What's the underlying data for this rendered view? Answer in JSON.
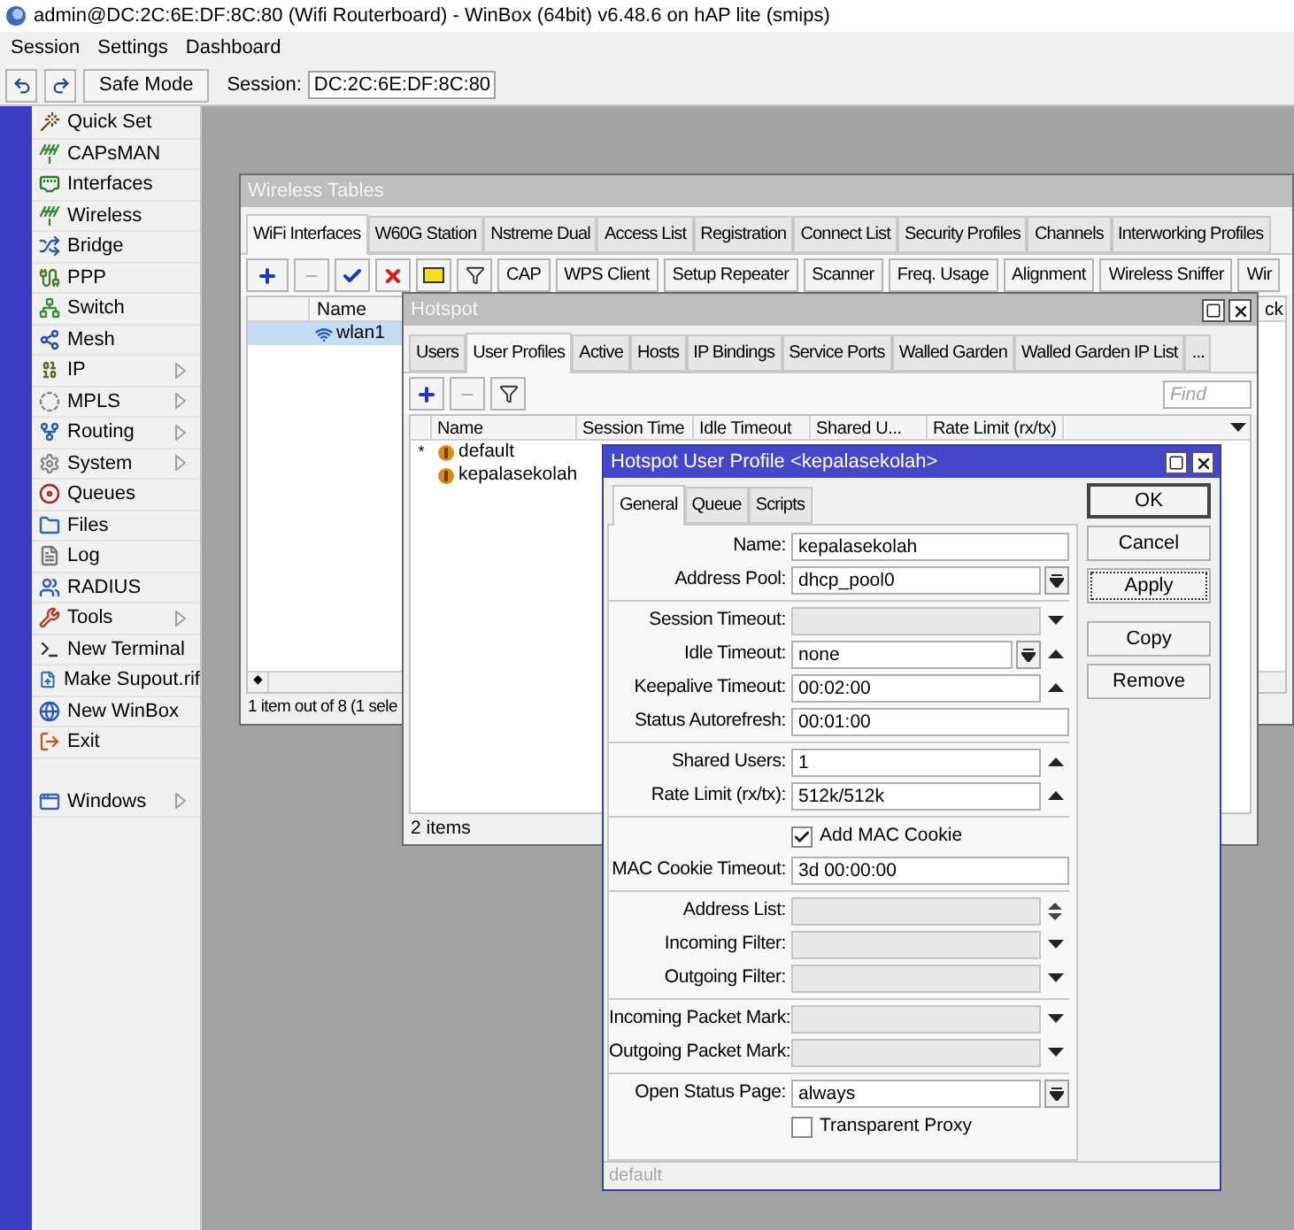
{
  "window": {
    "title": "admin@DC:2C:6E:DF:8C:80 (Wifi Routerboard) - WinBox (64bit) v6.48.6 on hAP lite (smips)"
  },
  "menu": [
    "Session",
    "Settings",
    "Dashboard"
  ],
  "toolbar": {
    "safe_mode": "Safe Mode",
    "session_label": "Session:",
    "session_value": "DC:2C:6E:DF:8C:80"
  },
  "sidebar": {
    "items": [
      {
        "label": "Quick Set",
        "submenu": false
      },
      {
        "label": "CAPsMAN",
        "submenu": false
      },
      {
        "label": "Interfaces",
        "submenu": false
      },
      {
        "label": "Wireless",
        "submenu": false
      },
      {
        "label": "Bridge",
        "submenu": false
      },
      {
        "label": "PPP",
        "submenu": false
      },
      {
        "label": "Switch",
        "submenu": false
      },
      {
        "label": "Mesh",
        "submenu": false
      },
      {
        "label": "IP",
        "submenu": true
      },
      {
        "label": "MPLS",
        "submenu": true
      },
      {
        "label": "Routing",
        "submenu": true
      },
      {
        "label": "System",
        "submenu": true
      },
      {
        "label": "Queues",
        "submenu": false
      },
      {
        "label": "Files",
        "submenu": false
      },
      {
        "label": "Log",
        "submenu": false
      },
      {
        "label": "RADIUS",
        "submenu": false
      },
      {
        "label": "Tools",
        "submenu": true
      },
      {
        "label": "New Terminal",
        "submenu": false
      },
      {
        "label": "Make Supout.rif",
        "submenu": false
      },
      {
        "label": "New WinBox",
        "submenu": false
      },
      {
        "label": "Exit",
        "submenu": false
      }
    ],
    "bottom_items": [
      {
        "label": "Windows",
        "submenu": true
      }
    ]
  },
  "wireless_tables": {
    "title": "Wireless Tables",
    "tabs": [
      {
        "label": "WiFi Interfaces",
        "selected": true
      },
      {
        "label": "W60G Station",
        "selected": false
      },
      {
        "label": "Nstreme Dual",
        "selected": false
      },
      {
        "label": "Access List",
        "selected": false
      },
      {
        "label": "Registration",
        "selected": false
      },
      {
        "label": "Connect List",
        "selected": false
      },
      {
        "label": "Security Profiles",
        "selected": false
      },
      {
        "label": "Channels",
        "selected": false
      },
      {
        "label": "Interworking Profiles",
        "selected": false
      }
    ],
    "tools": [
      "CAP",
      "WPS Client",
      "Setup Repeater",
      "Scanner",
      "Freq. Usage",
      "Alignment",
      "Wireless Sniffer",
      "Wir"
    ],
    "columns": [
      "Name",
      "ck"
    ],
    "rows": [
      {
        "name": "wlan1",
        "selected": true
      }
    ],
    "scroll_mark": "◆",
    "status": "1 item out of 8 (1 sele"
  },
  "hotspot": {
    "title": "Hotspot",
    "tabs": [
      {
        "label": "Users",
        "selected": false
      },
      {
        "label": "User Profiles",
        "selected": true
      },
      {
        "label": "Active",
        "selected": false
      },
      {
        "label": "Hosts",
        "selected": false
      },
      {
        "label": "IP Bindings",
        "selected": false
      },
      {
        "label": "Service Ports",
        "selected": false
      },
      {
        "label": "Walled Garden",
        "selected": false
      },
      {
        "label": "Walled Garden IP List",
        "selected": false
      },
      {
        "label": "...",
        "selected": false
      }
    ],
    "find_placeholder": "Find",
    "columns": [
      "Name",
      "Session Time",
      "Idle Timeout",
      "Shared U...",
      "Rate Limit (rx/tx)"
    ],
    "rows": [
      {
        "flag": "*",
        "name": "default",
        "selected": false
      },
      {
        "name": "kepalasekolah",
        "selected": false
      }
    ],
    "status": "2 items"
  },
  "dialog": {
    "title": "Hotspot User Profile <kepalasekolah>",
    "tabs": [
      {
        "label": "General",
        "selected": true
      },
      {
        "label": "Queue",
        "selected": false
      },
      {
        "label": "Scripts",
        "selected": false
      }
    ],
    "sections": [
      {
        "fields": [
          {
            "label": "Name:",
            "value": "kepalasekolah",
            "kind": "text"
          },
          {
            "label": "Address Pool:",
            "value": "dhcp_pool0",
            "kind": "select"
          }
        ]
      },
      {
        "fields": [
          {
            "label": "Session Timeout:",
            "kind": "empty_down"
          },
          {
            "label": "Idle Timeout:",
            "value": "none",
            "kind": "select_up"
          },
          {
            "label": "Keepalive Timeout:",
            "value": "00:02:00",
            "kind": "text_up"
          },
          {
            "label": "Status Autorefresh:",
            "value": "00:01:00",
            "kind": "text"
          }
        ]
      },
      {
        "fields": [
          {
            "label": "Shared Users:",
            "value": "1",
            "kind": "text_up"
          },
          {
            "label": "Rate Limit (rx/tx):",
            "value": "512k/512k",
            "kind": "text_up"
          }
        ]
      },
      {
        "fields": [
          {
            "label": "Add MAC Cookie",
            "kind": "checkbox",
            "checked": true
          },
          {
            "label": "MAC Cookie Timeout:",
            "value": "3d 00:00:00",
            "kind": "text"
          }
        ]
      },
      {
        "fields": [
          {
            "label": "Address List:",
            "kind": "empty_updown"
          },
          {
            "label": "Incoming Filter:",
            "kind": "empty_down"
          },
          {
            "label": "Outgoing Filter:",
            "kind": "empty_down"
          }
        ]
      },
      {
        "fields": [
          {
            "label": "Incoming Packet Mark:",
            "kind": "empty_down"
          },
          {
            "label": "Outgoing Packet Mark:",
            "kind": "empty_down"
          }
        ]
      },
      {
        "fields": [
          {
            "label": "Open Status Page:",
            "value": "always",
            "kind": "select"
          },
          {
            "label": "Transparent Proxy",
            "kind": "checkbox",
            "checked": false
          }
        ]
      }
    ],
    "buttons": [
      {
        "label": "OK",
        "default": true,
        "focused": false
      },
      {
        "label": "Cancel",
        "default": false,
        "focused": false
      },
      {
        "label": "Apply",
        "default": false,
        "focused": true
      },
      {
        "label": "Copy",
        "default": false,
        "focused": false
      },
      {
        "label": "Remove",
        "default": false,
        "focused": false
      }
    ],
    "status": "default"
  }
}
